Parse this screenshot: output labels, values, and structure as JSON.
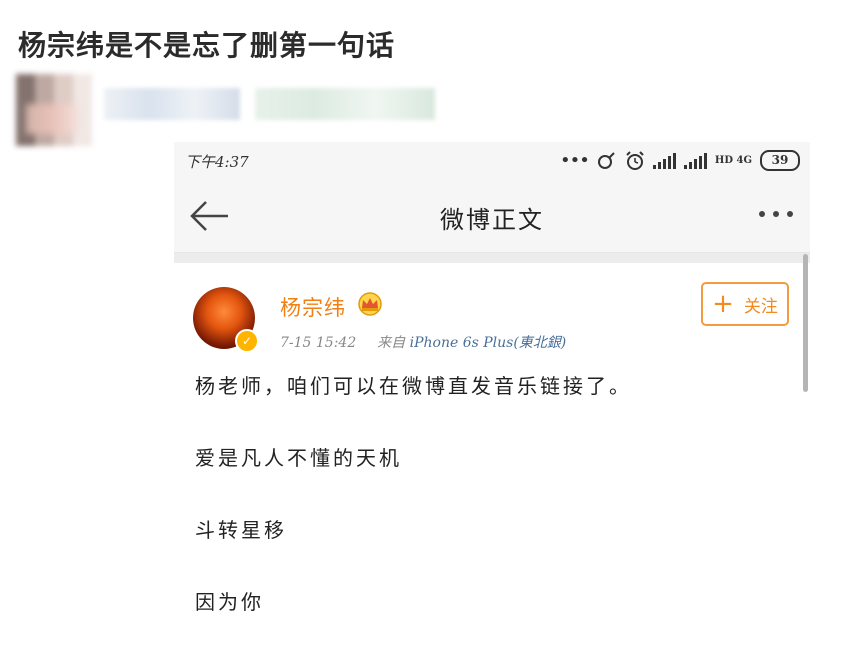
{
  "post": {
    "title": "杨宗纬是不是忘了删第一句话"
  },
  "status_bar": {
    "time": "下午4:37",
    "network": "HD 4G",
    "battery": "39"
  },
  "nav": {
    "title": "微博正文"
  },
  "weibo": {
    "username": "杨宗纬",
    "follow_label": "关注",
    "date_time": "7-15 15:42",
    "from_label": "来自",
    "source": "iPhone 6s Plus(東北銀)",
    "lines": [
      "杨老师，咱们可以在微博直发音乐链接了。",
      "爱是凡人不懂的天机",
      "斗转星移",
      "因为你"
    ]
  },
  "colors": {
    "accent_orange": "#f27f12",
    "follow_border": "#f29b3f",
    "link_blue": "#4a6f9a"
  }
}
